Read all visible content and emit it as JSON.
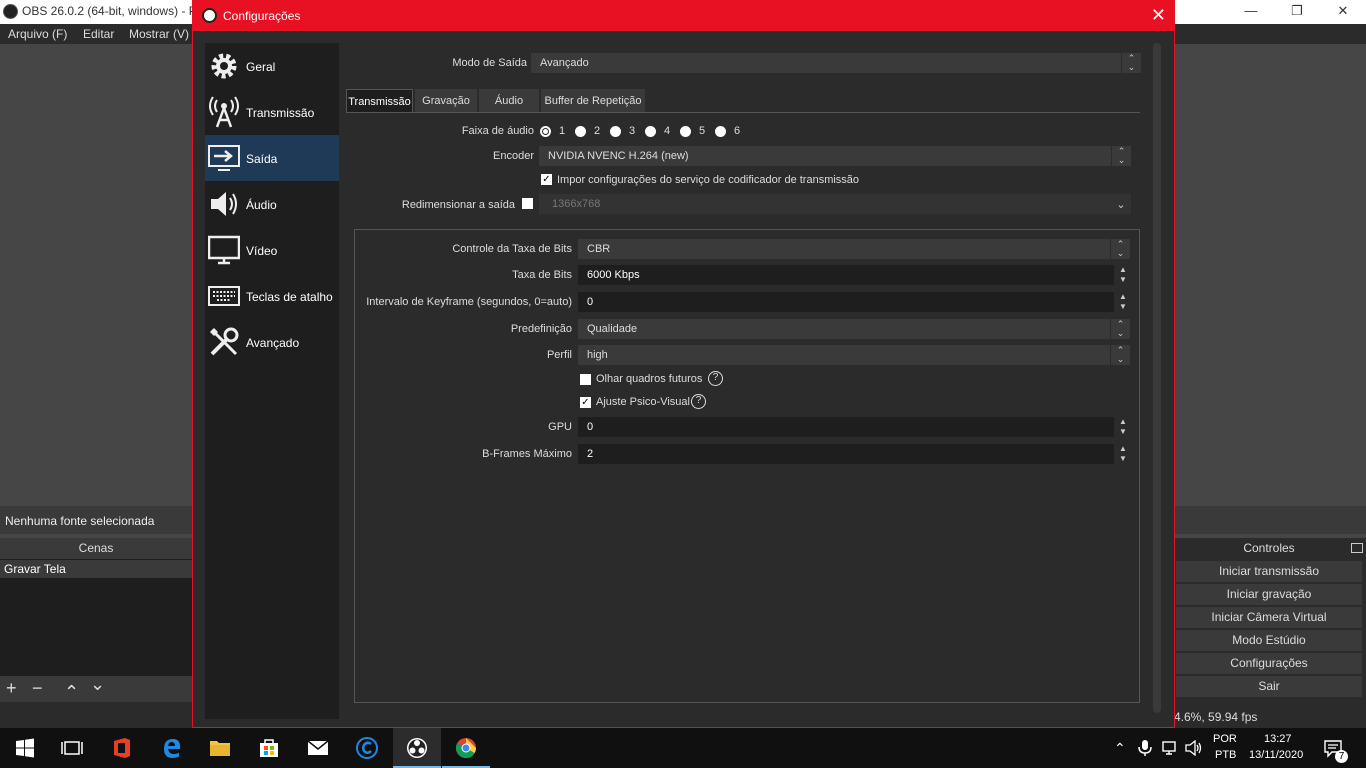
{
  "main_window": {
    "title": "OBS 26.0.2 (64-bit, windows) - P",
    "menu": [
      "Arquivo (F)",
      "Editar",
      "Mostrar (V)"
    ],
    "no_source": "Nenhuma fonte selecionada",
    "scenes_header": "Cenas",
    "scenes": [
      "Gravar Tela"
    ],
    "scene_tools": [
      "+",
      "−",
      "⌃",
      "⌄"
    ],
    "controls_header": "Controles",
    "controls": [
      "Iniciar transmissão",
      "Iniciar gravação",
      "Iniciar Câmera Virtual",
      "Modo Estúdio",
      "Configurações",
      "Sair"
    ],
    "status": "4.6%, 59.94 fps"
  },
  "dialog": {
    "title": "Configurações",
    "close": "✕",
    "sidebar": [
      {
        "label": "Geral",
        "icon": "gear-icon"
      },
      {
        "label": "Transmissão",
        "icon": "broadcast-icon"
      },
      {
        "label": "Saída",
        "icon": "output-icon"
      },
      {
        "label": "Áudio",
        "icon": "speaker-icon"
      },
      {
        "label": "Vídeo",
        "icon": "monitor-icon"
      },
      {
        "label": "Teclas de atalho",
        "icon": "keyboard-icon"
      },
      {
        "label": "Avançado",
        "icon": "tools-icon"
      }
    ],
    "output_mode_label": "Modo de Saída",
    "output_mode_value": "Avançado",
    "tabs": [
      "Transmissão",
      "Gravação",
      "Áudio",
      "Buffer de Repetição"
    ],
    "audio_track_label": "Faixa de áudio",
    "audio_tracks": [
      "1",
      "2",
      "3",
      "4",
      "5",
      "6"
    ],
    "encoder_label": "Encoder",
    "encoder_value": "NVIDIA NVENC H.264 (new)",
    "enforce_label": "Impor configurações do serviço de codificador de transmissão",
    "rescale_label": "Redimensionar a saída",
    "rescale_value": "1366x768",
    "rate_control_label": "Controle da Taxa de Bits",
    "rate_control_value": "CBR",
    "bitrate_label": "Taxa de Bits",
    "bitrate_value": "6000 Kbps",
    "keyframe_label": "Intervalo de Keyframe (segundos, 0=auto)",
    "keyframe_value": "0",
    "preset_label": "Predefinição",
    "preset_value": "Qualidade",
    "profile_label": "Perfil",
    "profile_value": "high",
    "lookahead_label": "Olhar quadros futuros",
    "psycho_label": "Ajuste Psico-Visual",
    "gpu_label": "GPU",
    "gpu_value": "0",
    "bframes_label": "B-Frames Máximo",
    "bframes_value": "2"
  },
  "taskbar": {
    "lang_top": "POR",
    "lang_bottom": "PTB",
    "time": "13:27",
    "date": "13/11/2020",
    "notif_count": "7"
  }
}
